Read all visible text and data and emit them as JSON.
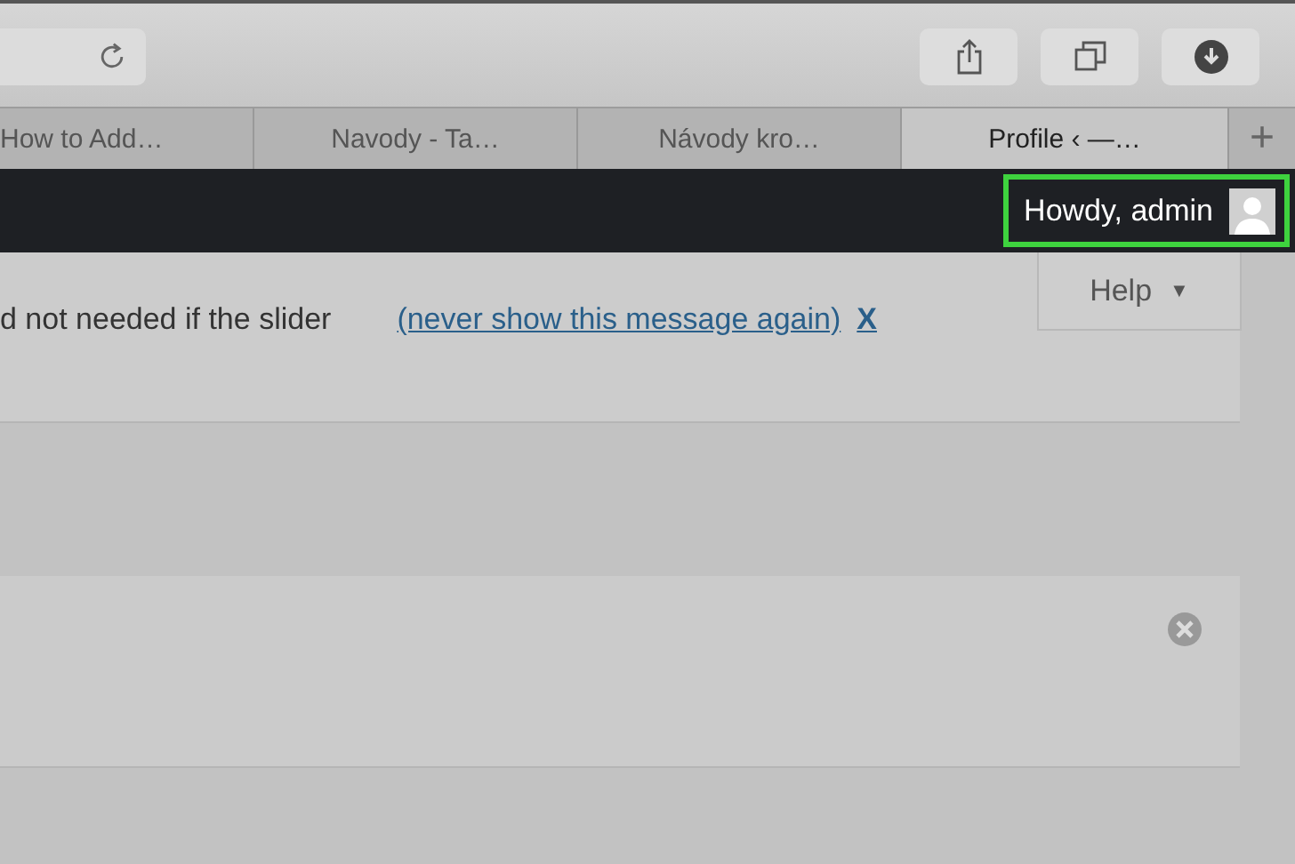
{
  "browser_tabs": [
    {
      "label": "How to Add…",
      "selected": false
    },
    {
      "label": "Navody - Ta…",
      "selected": false
    },
    {
      "label": "Návody kro…",
      "selected": false
    },
    {
      "label": "Profile ‹ —…",
      "selected": true
    }
  ],
  "new_tab": "+",
  "admin_bar": {
    "greeting": "Howdy, admin",
    "highlighted": true
  },
  "notice": {
    "text": "d not needed if the slider",
    "link": "(never show this message again)",
    "dismiss": "X"
  },
  "help_tab": {
    "label": "Help",
    "caret": "▼"
  }
}
